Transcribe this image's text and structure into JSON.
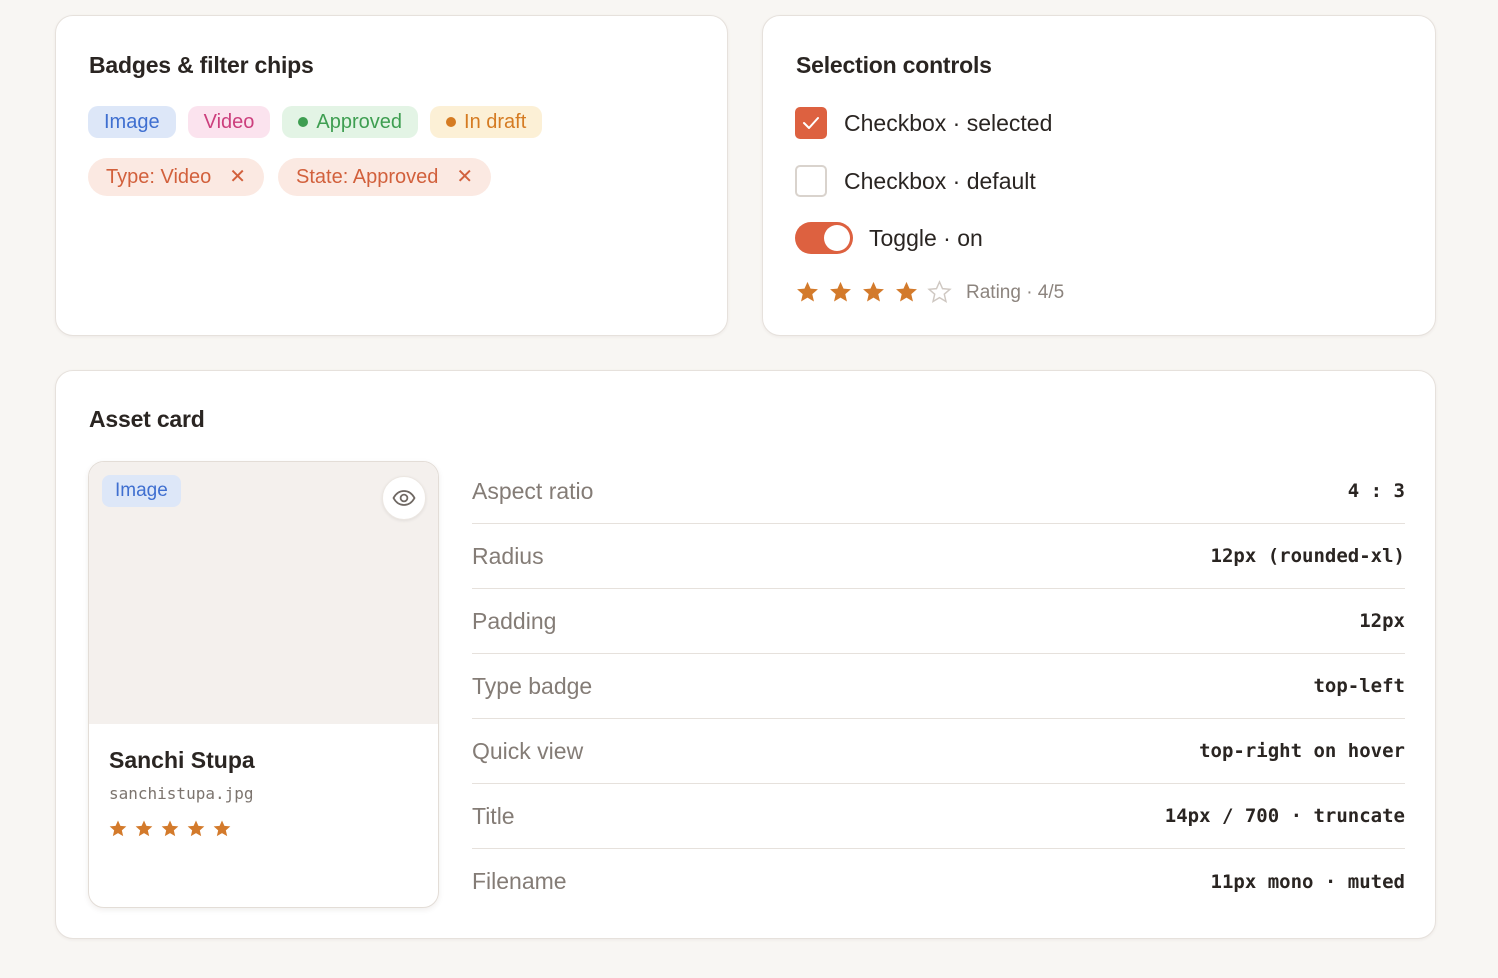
{
  "badges_card": {
    "title": "Badges & filter chips",
    "badges": [
      {
        "label": "Image",
        "bg": "#dde7f8",
        "fg": "#3f6fd0",
        "dot": false
      },
      {
        "label": "Video",
        "bg": "#fbe3ee",
        "fg": "#cc3f7d",
        "dot": false
      },
      {
        "label": "Approved",
        "bg": "#e3f4e5",
        "fg": "#3e9e51",
        "dot": true
      },
      {
        "label": "In draft",
        "bg": "#fcf0d6",
        "fg": "#d57b22",
        "dot": true
      }
    ],
    "chips": [
      {
        "label": "Type: Video",
        "remove_icon": "close-icon"
      },
      {
        "label": "State: Approved",
        "remove_icon": "close-icon"
      }
    ]
  },
  "selection_card": {
    "title": "Selection controls",
    "checkbox_selected_label": "Checkbox · selected",
    "checkbox_default_label": "Checkbox · default",
    "toggle_label": "Toggle · on",
    "rating_label": "Rating · 4/5",
    "rating_value": 4,
    "rating_max": 5,
    "accent": "#dd6140",
    "star_color": "#d37a2b"
  },
  "asset_card": {
    "title": "Asset card",
    "preview": {
      "type_badge": "Image",
      "quick_view_icon": "eye-icon",
      "title": "Sanchi Stupa",
      "filename": "sanchistupa.jpg",
      "rating_value": 5,
      "rating_max": 5
    },
    "specs": [
      {
        "key": "Aspect ratio",
        "value": "4 : 3"
      },
      {
        "key": "Radius",
        "value": "12px (rounded-xl)"
      },
      {
        "key": "Padding",
        "value": "12px"
      },
      {
        "key": "Type badge",
        "value": "top-left"
      },
      {
        "key": "Quick view",
        "value": "top-right on hover"
      },
      {
        "key": "Title",
        "value": "14px / 700 · truncate"
      },
      {
        "key": "Filename",
        "value": "11px mono · muted"
      }
    ]
  }
}
